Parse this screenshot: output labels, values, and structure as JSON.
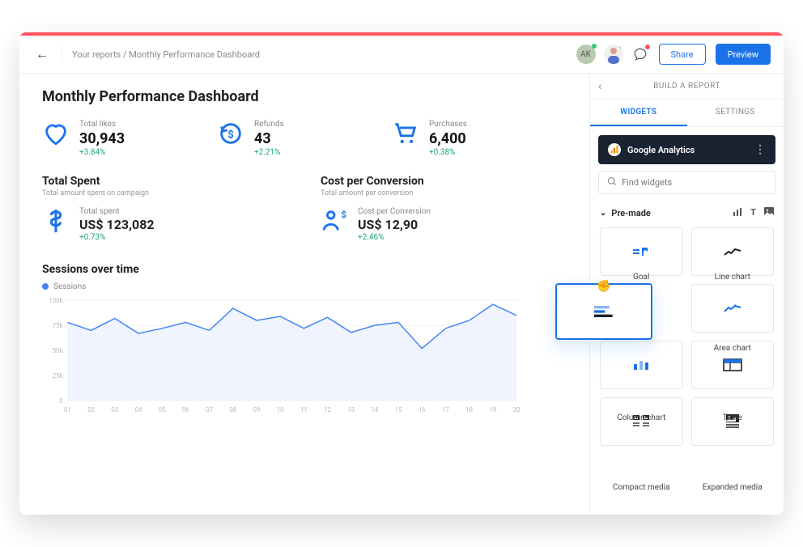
{
  "header": {
    "breadcrumb": "Your reports / Monthly Performance Dashboard",
    "avatar_initials": "AK",
    "share_label": "Share",
    "preview_label": "Preview"
  },
  "page_title": "Monthly Performance Dashboard",
  "kpis": {
    "likes": {
      "label": "Total likes",
      "value": "30,943",
      "change": "+3.84%"
    },
    "refunds": {
      "label": "Refunds",
      "value": "43",
      "change": "+2.21%"
    },
    "purchases": {
      "label": "Purchases",
      "value": "6,400",
      "change": "+0.38%"
    }
  },
  "total_spent": {
    "title": "Total Spent",
    "subtitle": "Total amount spent on campaign",
    "stat_label": "Total spent",
    "value": "US$ 123,082",
    "change": "+0.73%"
  },
  "cost_per_conversion": {
    "title": "Cost per Conversion",
    "subtitle": "Total amount per conversion",
    "stat_label": "Cost per Conversion",
    "value": "US$ 12,90",
    "change": "+2.46%"
  },
  "chart_section": {
    "title": "Sessions over time",
    "legend": "Sessions"
  },
  "chart_data": {
    "type": "area",
    "title": "Sessions over time",
    "xlabel": "",
    "ylabel": "",
    "ylim": [
      0,
      100000
    ],
    "y_ticks": [
      "0",
      "25k",
      "50k",
      "75k",
      "100k"
    ],
    "categories": [
      "01",
      "02",
      "03",
      "04",
      "05",
      "06",
      "07",
      "08",
      "09",
      "10",
      "11",
      "12",
      "13",
      "14",
      "15",
      "16",
      "17",
      "18",
      "19",
      "20"
    ],
    "series": [
      {
        "name": "Sessions",
        "values": [
          78000,
          70000,
          82000,
          67000,
          72000,
          78000,
          70000,
          92000,
          80000,
          84000,
          72000,
          83000,
          68000,
          75000,
          78000,
          52000,
          72000,
          80000,
          96000,
          85000
        ]
      }
    ]
  },
  "sidebar": {
    "panel_title": "BUILD A REPORT",
    "tab_widgets": "WIDGETS",
    "tab_settings": "SETTINGS",
    "integration_name": "Google Analytics",
    "search_placeholder": "Find widgets",
    "section_premade": "Pre-made",
    "widgets": {
      "goal": "Goal",
      "line": "Line chart",
      "area": "Area chart",
      "column": "Column chart",
      "table": "Table",
      "compact": "Compact media",
      "expanded": "Expanded media"
    }
  }
}
